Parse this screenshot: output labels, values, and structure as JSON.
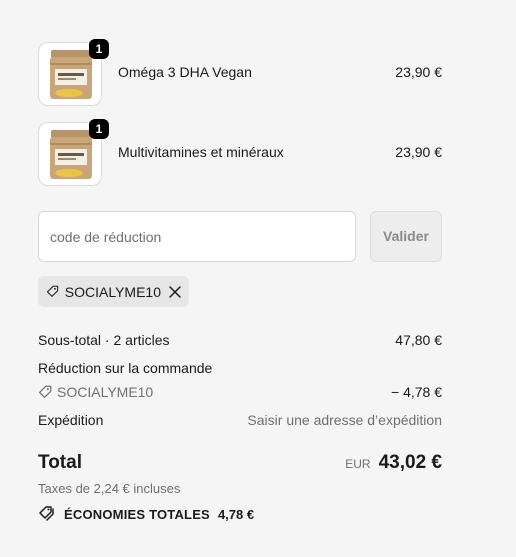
{
  "cart": {
    "items": [
      {
        "name": "Oméga 3 DHA Vegan",
        "price": "23,90 €",
        "quantity": "1"
      },
      {
        "name": "Multivitamines et minéraux",
        "price": "23,90 €",
        "quantity": "1"
      }
    ]
  },
  "discount": {
    "placeholder": "code de réduction",
    "apply_label": "Valider",
    "applied_code": "SOCIALYME10"
  },
  "summary": {
    "subtotal_label": "Sous-total · 2 articles",
    "subtotal_value": "47,80 €",
    "order_discount_label": "Réduction sur la commande",
    "discount_code": "SOCIALYME10",
    "discount_value": "− 4,78 €",
    "shipping_label": "Expédition",
    "shipping_value": "Saisir une adresse d’expédition",
    "total_label": "Total",
    "currency": "EUR",
    "total_value": "43,02 €",
    "taxes_text": "Taxes de 2,24 € incluses",
    "savings_label": "ÉCONOMIES TOTALES",
    "savings_value": "4,78 €"
  },
  "icons": {
    "tag": "tag-icon",
    "close": "close-icon",
    "savings": "price-tags-icon"
  },
  "colors": {
    "background": "#f5f5f5",
    "badge": "#000000",
    "muted_text": "#707070",
    "chip": "#e6e6e6"
  }
}
